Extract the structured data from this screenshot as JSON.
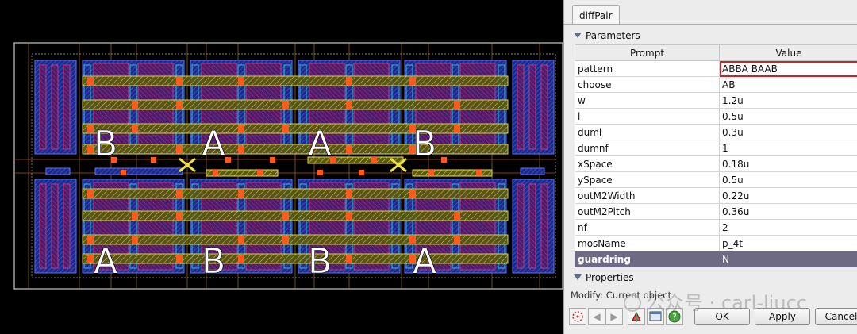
{
  "layout_view": {
    "device_labels": [
      "B",
      "A",
      "A",
      "B",
      "A",
      "B",
      "B",
      "A"
    ]
  },
  "panel": {
    "tab": "diffPair",
    "section_parameters": "Parameters",
    "columns": {
      "prompt": "Prompt",
      "value": "Value"
    },
    "rows": [
      {
        "prompt": "pattern",
        "value": "ABBA BAAB"
      },
      {
        "prompt": "choose",
        "value": "AB"
      },
      {
        "prompt": "w",
        "value": "1.2u"
      },
      {
        "prompt": "l",
        "value": "0.5u"
      },
      {
        "prompt": "duml",
        "value": "0.3u"
      },
      {
        "prompt": "dumnf",
        "value": "1"
      },
      {
        "prompt": "xSpace",
        "value": "0.18u"
      },
      {
        "prompt": "ySpace",
        "value": "0.5u"
      },
      {
        "prompt": "outM2Width",
        "value": "0.22u"
      },
      {
        "prompt": "outM2Pitch",
        "value": "0.36u"
      },
      {
        "prompt": "nf",
        "value": "2"
      },
      {
        "prompt": "mosName",
        "value": "p_4t"
      },
      {
        "prompt": "guardring",
        "value": "N"
      }
    ],
    "section_properties": "Properties",
    "status": "Modify: Current object",
    "buttons": {
      "ok": "OK",
      "apply": "Apply",
      "cancel": "Cancel"
    }
  },
  "watermark": "公众号 · carl-liucc"
}
